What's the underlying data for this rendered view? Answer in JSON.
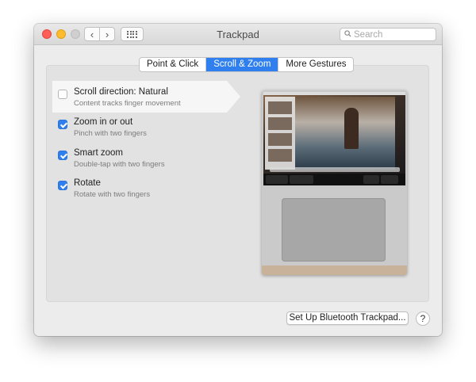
{
  "window": {
    "title": "Trackpad"
  },
  "toolbar": {
    "back_icon": "chevron-left-icon",
    "forward_icon": "chevron-right-icon",
    "grid_icon": "grid-icon"
  },
  "search": {
    "placeholder": "Search",
    "value": ""
  },
  "tabs": [
    {
      "label": "Point & Click",
      "active": false
    },
    {
      "label": "Scroll & Zoom",
      "active": true
    },
    {
      "label": "More Gestures",
      "active": false
    }
  ],
  "options": [
    {
      "title": "Scroll direction: Natural",
      "subtitle": "Content tracks finger movement",
      "checked": false,
      "selected": true
    },
    {
      "title": "Zoom in or out",
      "subtitle": "Pinch with two fingers",
      "checked": true,
      "selected": false
    },
    {
      "title": "Smart zoom",
      "subtitle": "Double-tap with two fingers",
      "checked": true,
      "selected": false
    },
    {
      "title": "Rotate",
      "subtitle": "Rotate with two fingers",
      "checked": true,
      "selected": false
    }
  ],
  "buttons": {
    "setup": "Set Up Bluetooth Trackpad...",
    "help": "?"
  },
  "colors": {
    "accent": "#2f80ee",
    "close": "#fe5f57",
    "minimize": "#febc2e"
  }
}
